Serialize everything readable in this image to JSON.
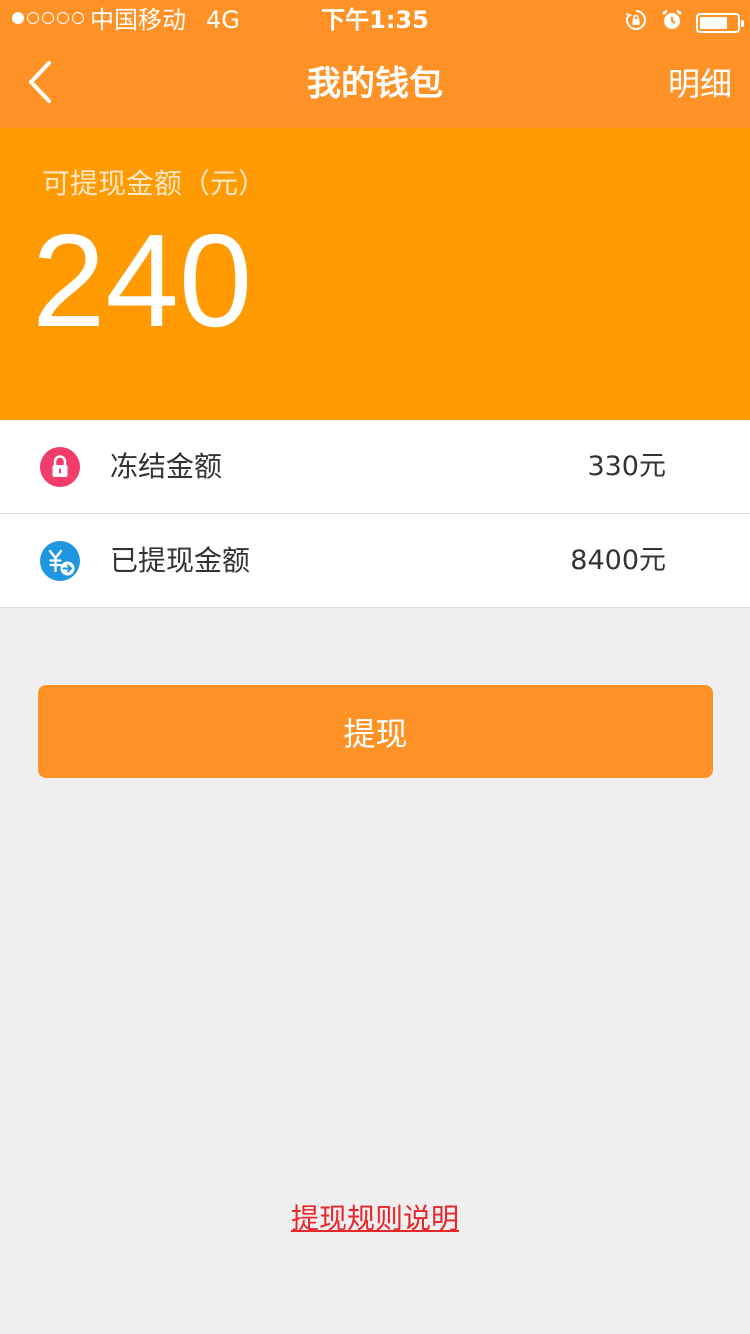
{
  "status_bar": {
    "carrier": "中国移动",
    "network": "4G",
    "time": "下午1:35",
    "signal_bars_filled": 1,
    "signal_bars_total": 5,
    "battery_level": 0.75,
    "icons": [
      "rotation-lock-icon",
      "alarm-icon",
      "battery-icon"
    ]
  },
  "nav": {
    "title": "我的钱包",
    "detail_label": "明细",
    "back_icon": "chevron-left-icon"
  },
  "balance": {
    "label": "可提现金额（元）",
    "amount": "240"
  },
  "rows": [
    {
      "icon": "lock-icon",
      "label": "冻结金额",
      "value": "330元",
      "icon_color": "#f23c6a"
    },
    {
      "icon": "yen-transfer-icon",
      "label": "已提现金额",
      "value": "8400元",
      "icon_color": "#1f96e0"
    }
  ],
  "withdraw_button": {
    "label": "提现"
  },
  "rules_link": {
    "label": "提现规则说明"
  },
  "colors": {
    "header": "#ff9226",
    "balance_panel": "#ff9a00",
    "background": "#efefef",
    "link": "#e8262b"
  }
}
